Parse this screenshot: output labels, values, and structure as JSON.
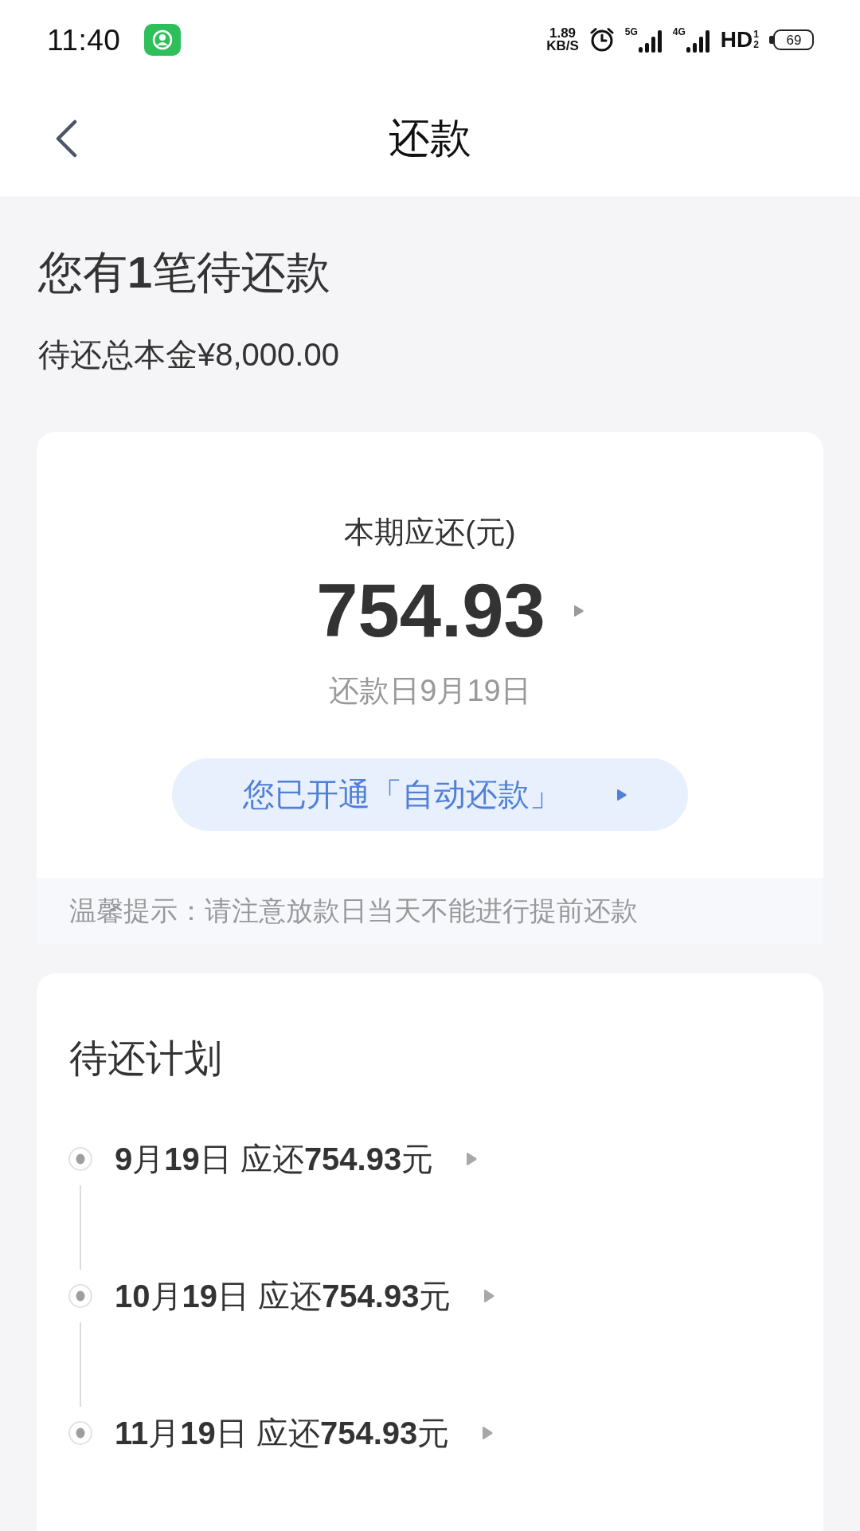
{
  "status_bar": {
    "time": "11:40",
    "speed_value": "1.89",
    "speed_unit": "KB/S",
    "signals": [
      {
        "label": "5G"
      },
      {
        "label": "4G"
      }
    ],
    "hd_label": "HD",
    "hd_slots": [
      "1",
      "2"
    ],
    "battery": "69"
  },
  "header": {
    "title": "还款"
  },
  "summary": {
    "headline": "您有**1**笔待还款",
    "principal": "待还总本金¥8,000.00"
  },
  "current_bill": {
    "label": "本期应还(元)",
    "amount": "754.93",
    "due_date": "还款日9月19日",
    "autopay_button": "您已开通「自动还款」",
    "tip": "温馨提示：请注意放款日当天不能进行提前还款"
  },
  "plan": {
    "title": "待还计划",
    "items": [
      {
        "text": "**9**月**19**日 应还**754.93**元"
      },
      {
        "text": "**10**月**19**日 应还**754.93**元"
      },
      {
        "text": "**11**月**19**日 应还**754.93**元"
      }
    ]
  }
}
